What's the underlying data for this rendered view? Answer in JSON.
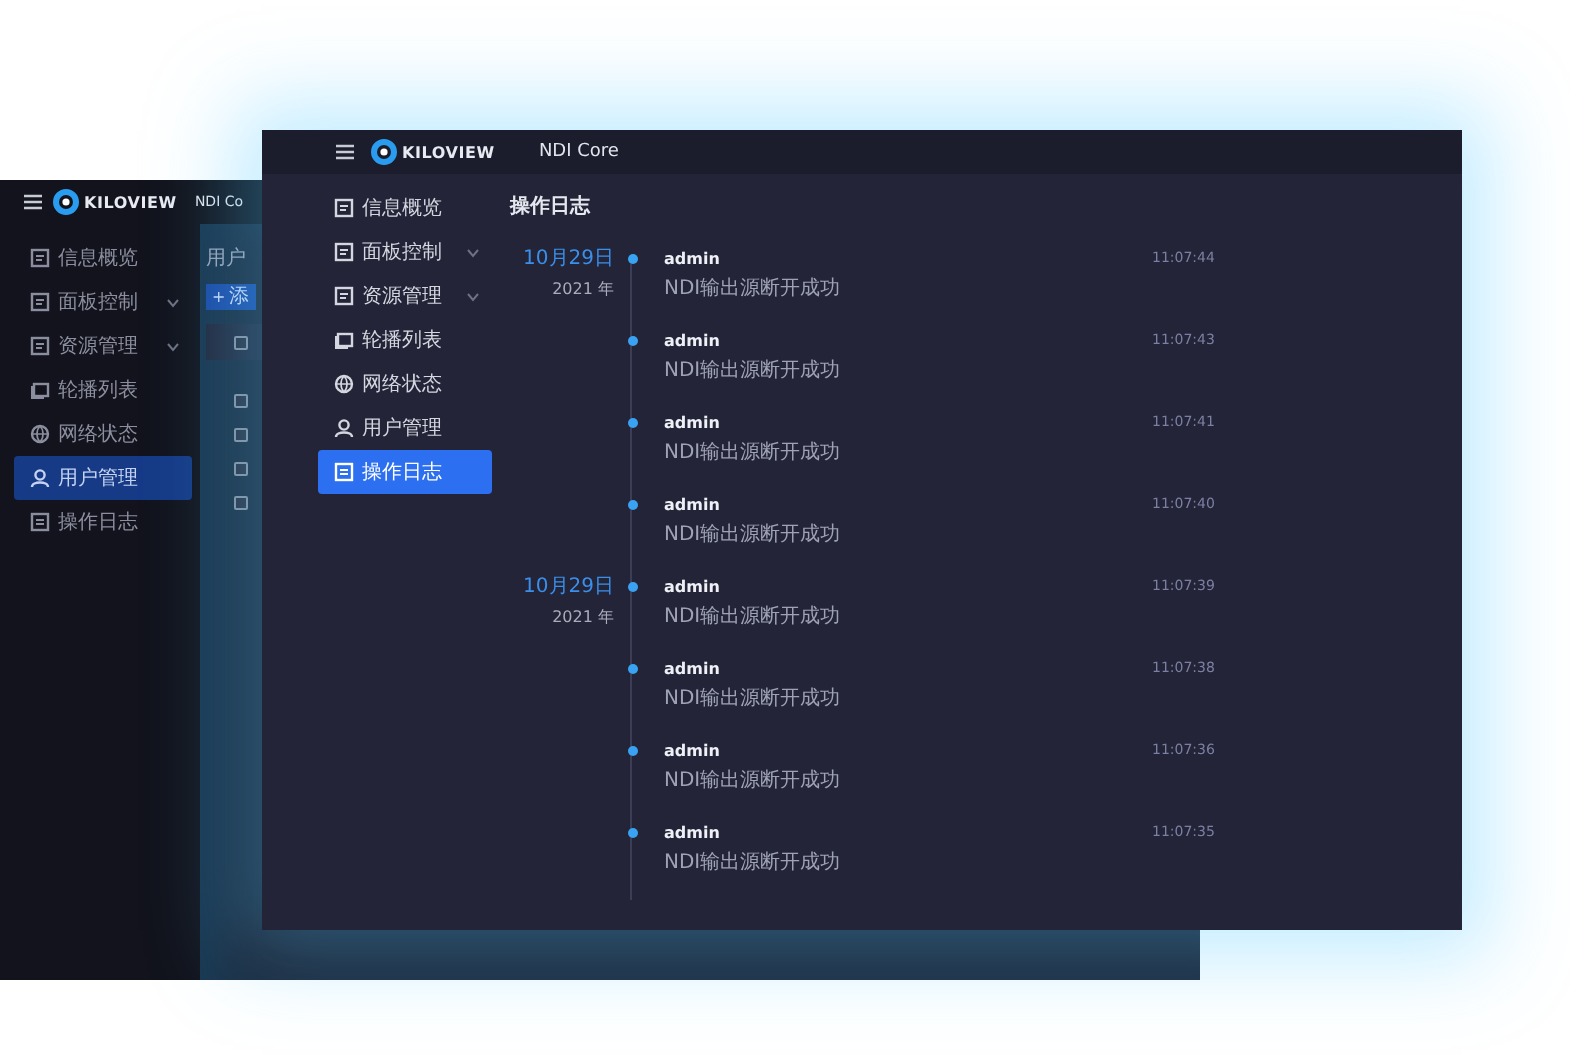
{
  "back_window": {
    "header": {
      "logo_text": "KILOVIEW",
      "title": "NDI Co"
    },
    "sidebar": {
      "items": [
        {
          "label": "信息概览",
          "selected": false
        },
        {
          "label": "面板控制",
          "selected": false,
          "expanded": false
        },
        {
          "label": "资源管理",
          "selected": false,
          "expanded": false
        },
        {
          "label": "轮播列表",
          "selected": false
        },
        {
          "label": "网络状态",
          "selected": false
        },
        {
          "label": "用户管理",
          "selected": true
        },
        {
          "label": "操作日志",
          "selected": false
        }
      ]
    },
    "content": {
      "title": "用户",
      "add_button": {
        "symbol": "+",
        "label": "添"
      },
      "header_checkbox": {
        "checked": false
      },
      "row_checkboxes": [
        {
          "checked": false
        },
        {
          "checked": false
        },
        {
          "checked": false
        },
        {
          "checked": false
        }
      ]
    }
  },
  "front_window": {
    "header": {
      "logo_text": "KILOVIEW",
      "title": "NDI Core"
    },
    "sidebar": {
      "items": [
        {
          "label": "信息概览",
          "selected": false
        },
        {
          "label": "面板控制",
          "selected": false,
          "expanded": false
        },
        {
          "label": "资源管理",
          "selected": false,
          "expanded": false
        },
        {
          "label": "轮播列表",
          "selected": false
        },
        {
          "label": "网络状态",
          "selected": false
        },
        {
          "label": "用户管理",
          "selected": false
        },
        {
          "label": "操作日志",
          "selected": true
        }
      ]
    },
    "content": {
      "title": "操作日志",
      "entries": [
        {
          "date": {
            "day": "10月29日",
            "year": "2021 年"
          },
          "user": "admin",
          "message": "NDI输出源断开成功",
          "time": "11:07:44"
        },
        {
          "user": "admin",
          "message": "NDI输出源断开成功",
          "time": "11:07:43"
        },
        {
          "user": "admin",
          "message": "NDI输出源断开成功",
          "time": "11:07:41"
        },
        {
          "user": "admin",
          "message": "NDI输出源断开成功",
          "time": "11:07:40"
        },
        {
          "date": {
            "day": "10月29日",
            "year": "2021 年"
          },
          "user": "admin",
          "message": "NDI输出源断开成功",
          "time": "11:07:39"
        },
        {
          "user": "admin",
          "message": "NDI输出源断开成功",
          "time": "11:07:38"
        },
        {
          "user": "admin",
          "message": "NDI输出源断开成功",
          "time": "11:07:36"
        },
        {
          "user": "admin",
          "message": "NDI输出源断开成功",
          "time": "11:07:35"
        }
      ]
    }
  }
}
